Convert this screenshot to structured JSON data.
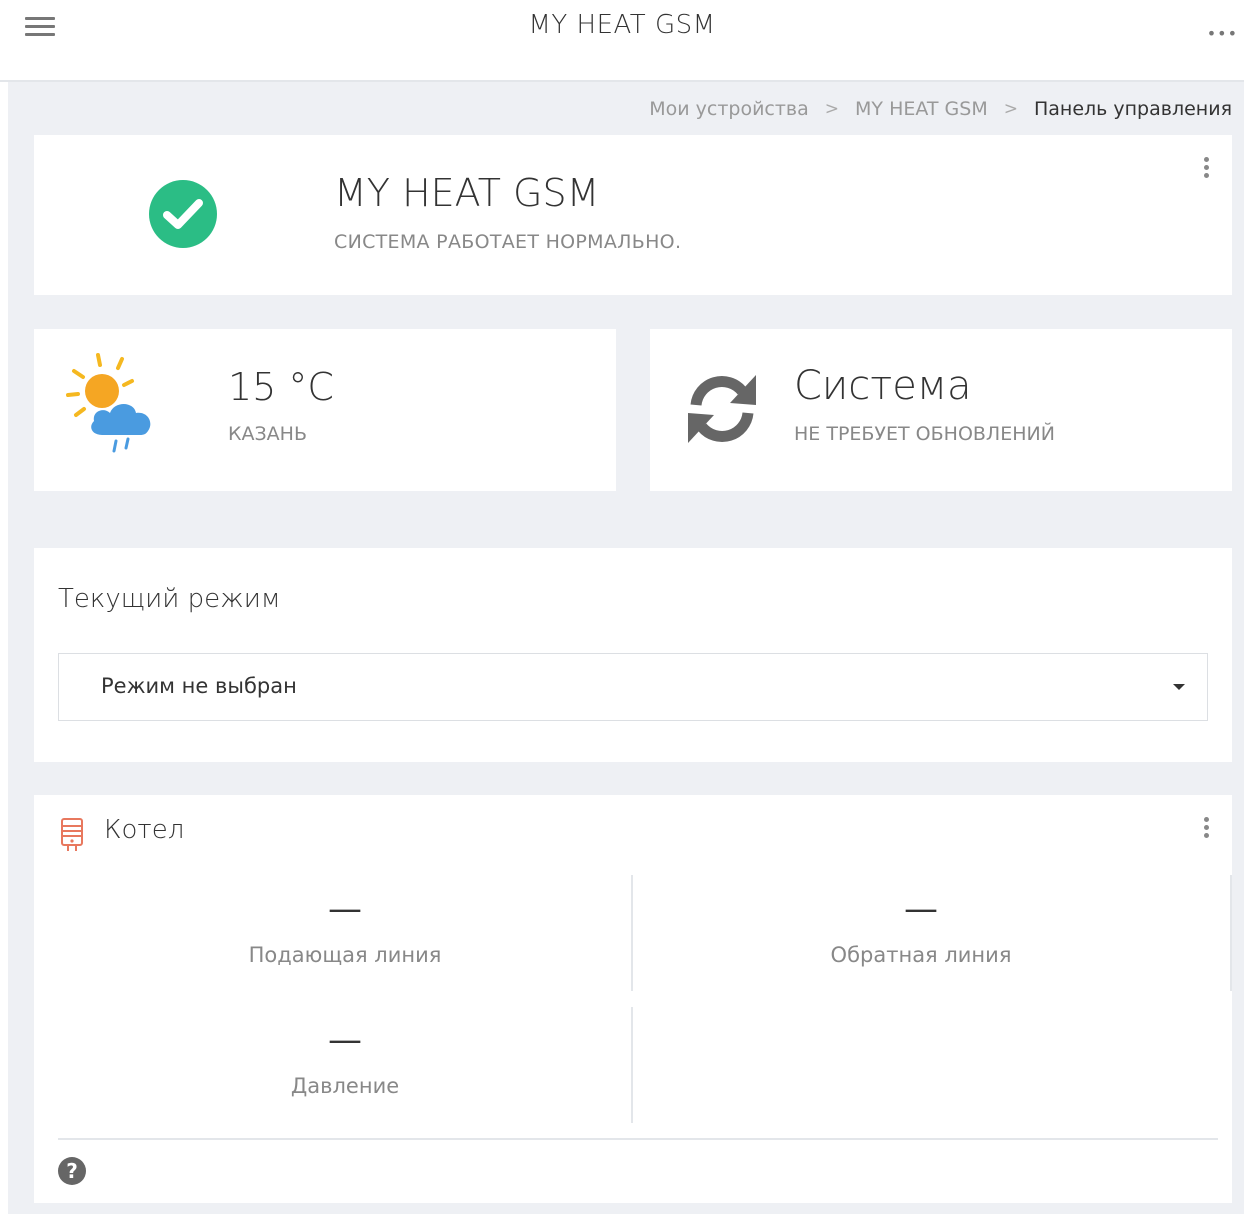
{
  "header": {
    "title": "MY HEAT GSM",
    "menu_icon": "hamburger-menu-icon",
    "more_icon": "more-horizontal-icon",
    "more_text": "•••"
  },
  "breadcrumb": {
    "items": [
      "Мои устройства",
      "MY HEAT GSM",
      "Панель управления"
    ],
    "separator": ">"
  },
  "status": {
    "title": "MY HEAT GSM",
    "subtitle": "СИСТЕМА РАБОТАЕТ НОРМАЛЬНО.",
    "icon": "check-circle-icon",
    "color": "#2bbd85"
  },
  "weather": {
    "temperature": "15 °C",
    "city": "КАЗАНЬ",
    "icon": "sun-cloud-rain-icon"
  },
  "system": {
    "title": "Система",
    "subtitle": "НЕ ТРЕБУЕТ ОБНОВЛЕНИЙ",
    "icon": "sync-icon"
  },
  "mode": {
    "label": "Текущий режим",
    "selected": "Режим не выбран"
  },
  "boiler": {
    "title": "Котел",
    "icon": "boiler-icon",
    "icon_color": "#e8785e",
    "metrics": [
      {
        "value": "—",
        "label": "Подающая линия"
      },
      {
        "value": "—",
        "label": "Обратная линия"
      },
      {
        "value": "—",
        "label": "Давление"
      }
    ],
    "help_icon": "help-circle-icon",
    "help_text": "?"
  }
}
